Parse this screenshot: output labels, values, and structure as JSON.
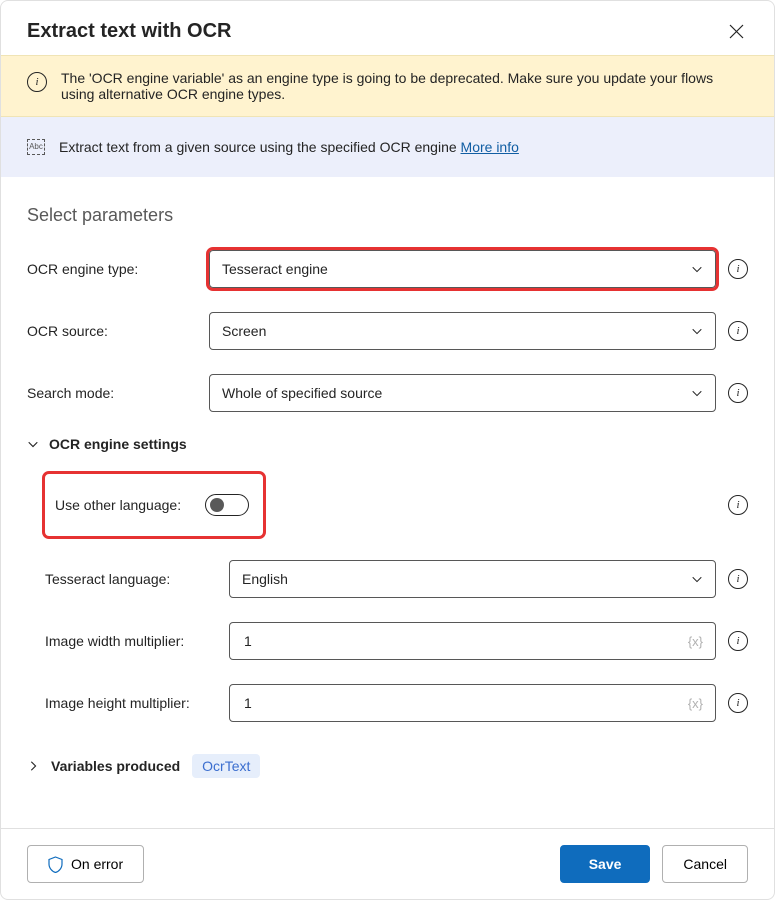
{
  "header": {
    "title": "Extract text with OCR"
  },
  "warning": {
    "text": "The 'OCR engine variable' as an engine type is going to be deprecated.  Make sure you update your flows using alternative OCR engine types."
  },
  "info": {
    "text": "Extract text from a given source using the specified OCR engine ",
    "link": "More info"
  },
  "section_title": "Select parameters",
  "fields": {
    "engine_type": {
      "label": "OCR engine type:",
      "value": "Tesseract engine"
    },
    "ocr_source": {
      "label": "OCR source:",
      "value": "Screen"
    },
    "search_mode": {
      "label": "Search mode:",
      "value": "Whole of specified source"
    }
  },
  "engine_settings": {
    "header": "OCR engine settings",
    "use_other_language": {
      "label": "Use other language:"
    },
    "language": {
      "label": "Tesseract language:",
      "value": "English"
    },
    "width_mult": {
      "label": "Image width multiplier:",
      "value": "1"
    },
    "height_mult": {
      "label": "Image height multiplier:",
      "value": "1"
    }
  },
  "variables": {
    "header": "Variables produced",
    "chip": "OcrText"
  },
  "footer": {
    "on_error": "On error",
    "save": "Save",
    "cancel": "Cancel"
  }
}
